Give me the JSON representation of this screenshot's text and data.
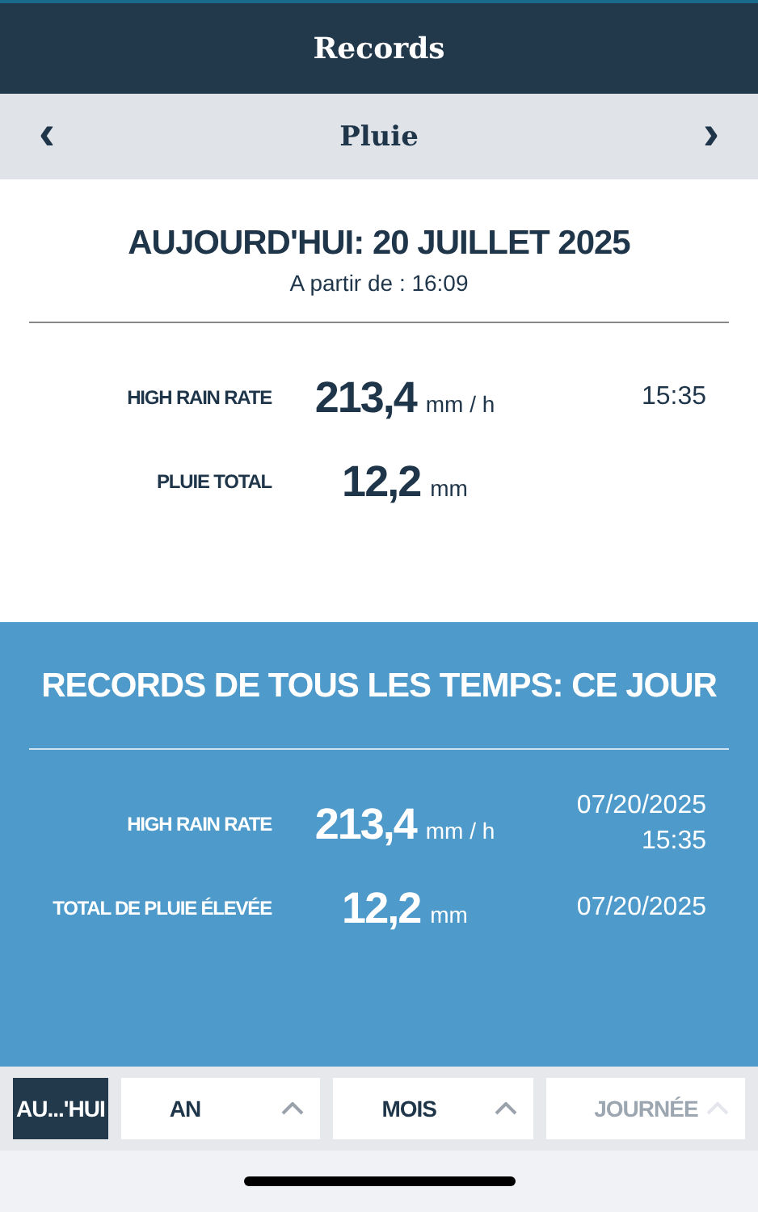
{
  "header": {
    "title": "Records"
  },
  "category_nav": {
    "prev": "‹",
    "title": "Pluie",
    "next": "›"
  },
  "today": {
    "title": "AUJOURD'HUI: 20 JUILLET 2025",
    "subtitle": "A partir de : 16:09",
    "rows": [
      {
        "label": "HIGH RAIN RATE",
        "value": "213,4",
        "unit": "mm / h",
        "time": [
          "15:35"
        ]
      },
      {
        "label": "PLUIE TOTAL",
        "value": "12,2",
        "unit": "mm",
        "time": []
      }
    ]
  },
  "all_time": {
    "title": "RECORDS DE TOUS LES TEMPS: CE JOUR",
    "rows": [
      {
        "label": "HIGH RAIN RATE",
        "value": "213,4",
        "unit": "mm / h",
        "time": [
          "07/20/2025",
          "15:35"
        ]
      },
      {
        "label": "TOTAL DE PLUIE ÉLEVÉE",
        "value": "12,2",
        "unit": "mm",
        "time": [
          "07/20/2025"
        ]
      }
    ]
  },
  "period_tabs": [
    {
      "label": "AU...'HUI",
      "selected": true,
      "disabled": false,
      "dropdown": false
    },
    {
      "label": "AN",
      "selected": false,
      "disabled": false,
      "dropdown": true
    },
    {
      "label": "MOIS",
      "selected": false,
      "disabled": false,
      "dropdown": true
    },
    {
      "label": "JOURNÉE",
      "selected": false,
      "disabled": true,
      "dropdown": true
    }
  ]
}
